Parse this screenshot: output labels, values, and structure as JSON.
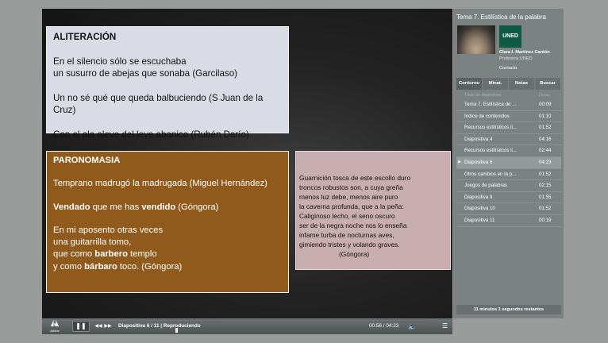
{
  "slide": {
    "alliteration": {
      "title": "ALITERACIÓN",
      "line1": "En el silencio sólo se escuchaba",
      "line2": "un susurro de abejas que sonaba (Garcilaso)",
      "line3": "Un no sé qué que queda balbuciendo (S Juan de la Cruz)",
      "line4": "Con el ala aleve del leve abanico (Rubén Darío)"
    },
    "paronomasia": {
      "title": "PARONOMASIA",
      "line1": "Temprano madrugó la madrugada (Miguel Hernández)",
      "line2_bold1": "Vendado",
      "line2_mid": " que me has ",
      "line2_bold2": "vendido",
      "line2_end": " (Góngora)",
      "line3": "En mi aposento otras veces",
      "line4": "una guitarrilla tomo,",
      "line5_start": "que como ",
      "line5_bold": "barbero",
      "line5_end": " templo",
      "line6_start": "y como ",
      "line6_bold": "bárbaro",
      "line6_end": " toco. (Góngora)"
    },
    "gongora": {
      "lines": [
        "Guarnición tosca de este escollo duro",
        "troncos robustos son, a cuya greña",
        "menos luz debe, menos aire puro",
        "la caverna profunda, que a la peña:",
        "Caliginoso lecho, el seno oscuro",
        "ser de la negra noche nos lo enseña",
        "infame turba de nocturnas aves,",
        "gimiendo tristes y volando graves."
      ],
      "author": "(Góngora)"
    }
  },
  "controls": {
    "logo": "Adobe",
    "status": "Diapositiva 6 / 11 | Reproduciendo",
    "time": "00:56 / 04:23"
  },
  "sidebar": {
    "title": "Tema 7. Estilística de la palabra",
    "logo_text": "UNED",
    "presenter_name": "Clara I. Martínez Cantón",
    "presenter_role": "Profesora UNED",
    "contact": "Contacto",
    "tabs": [
      "Contorno",
      "Minat.",
      "Notas",
      "Buscar"
    ],
    "outline_header": {
      "title": "Título de diapositiva",
      "duration": "Durac."
    },
    "outline": [
      {
        "title": "Tema 7. Estilística de ...",
        "duration": "00:09"
      },
      {
        "title": "Índice de contenidos",
        "duration": "01:10"
      },
      {
        "title": "Recursos estilísticos li...",
        "duration": "01:52"
      },
      {
        "title": "Diapositiva 4",
        "duration": "04:16"
      },
      {
        "title": "Recursos estilísticos li...",
        "duration": "02:44"
      },
      {
        "title": "Diapositiva 6",
        "duration": "04:23"
      },
      {
        "title": "Otros cambios en la p...",
        "duration": "01:52"
      },
      {
        "title": "Juegos de palabras",
        "duration": "02:15"
      },
      {
        "title": "Diapositiva 9",
        "duration": "01:55"
      },
      {
        "title": "Diapositiva 10",
        "duration": "01:52"
      },
      {
        "title": "Diapositiva 11",
        "duration": "00:19"
      }
    ],
    "active_index": 5,
    "remaining": "11 minutos 1 segundos restantes"
  }
}
